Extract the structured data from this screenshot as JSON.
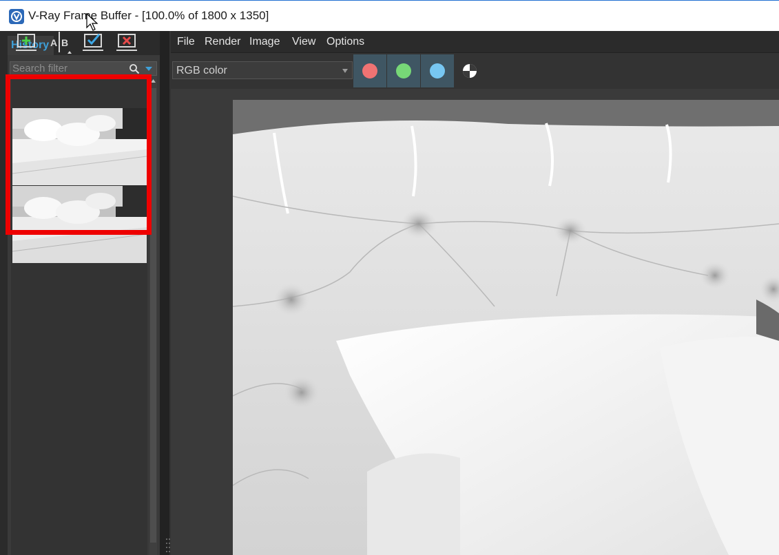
{
  "window": {
    "title": "V-Ray Frame Buffer - [100.0% of 1800 x 1350]",
    "icon": "vray-logo-icon"
  },
  "history": {
    "tab_label": "History",
    "toolbar": [
      {
        "name": "save-to-history-button",
        "icon": "add-icon"
      },
      {
        "name": "ab-compare-button",
        "icon": "ab-compare-icon"
      },
      {
        "name": "load-from-history-button",
        "icon": "checkmark-icon"
      },
      {
        "name": "remove-from-history-button",
        "icon": "delete-icon"
      }
    ],
    "search": {
      "placeholder": "Search filter",
      "value": ""
    },
    "items": [
      {
        "thumbnail": "bed-render-thumbnail-1"
      },
      {
        "thumbnail": "bed-render-thumbnail-2"
      }
    ],
    "highlight_color": "#ee0000"
  },
  "menu": {
    "file": "File",
    "render": "Render",
    "image": "Image",
    "view": "View",
    "options": "Options"
  },
  "toolbar": {
    "channel": "RGB color",
    "channels": [
      {
        "name": "red-channel",
        "color": "#f07373"
      },
      {
        "name": "green-channel",
        "color": "#77d877"
      },
      {
        "name": "blue-channel",
        "color": "#77c7f2"
      }
    ],
    "alpha_icon": "alpha-channel-icon"
  },
  "render": {
    "subject": "white tufted bed headboard with pillows"
  },
  "colors": {
    "accent": "#3ea0d9",
    "panel": "#2b2b2b",
    "channel_button": "#3f5663"
  }
}
